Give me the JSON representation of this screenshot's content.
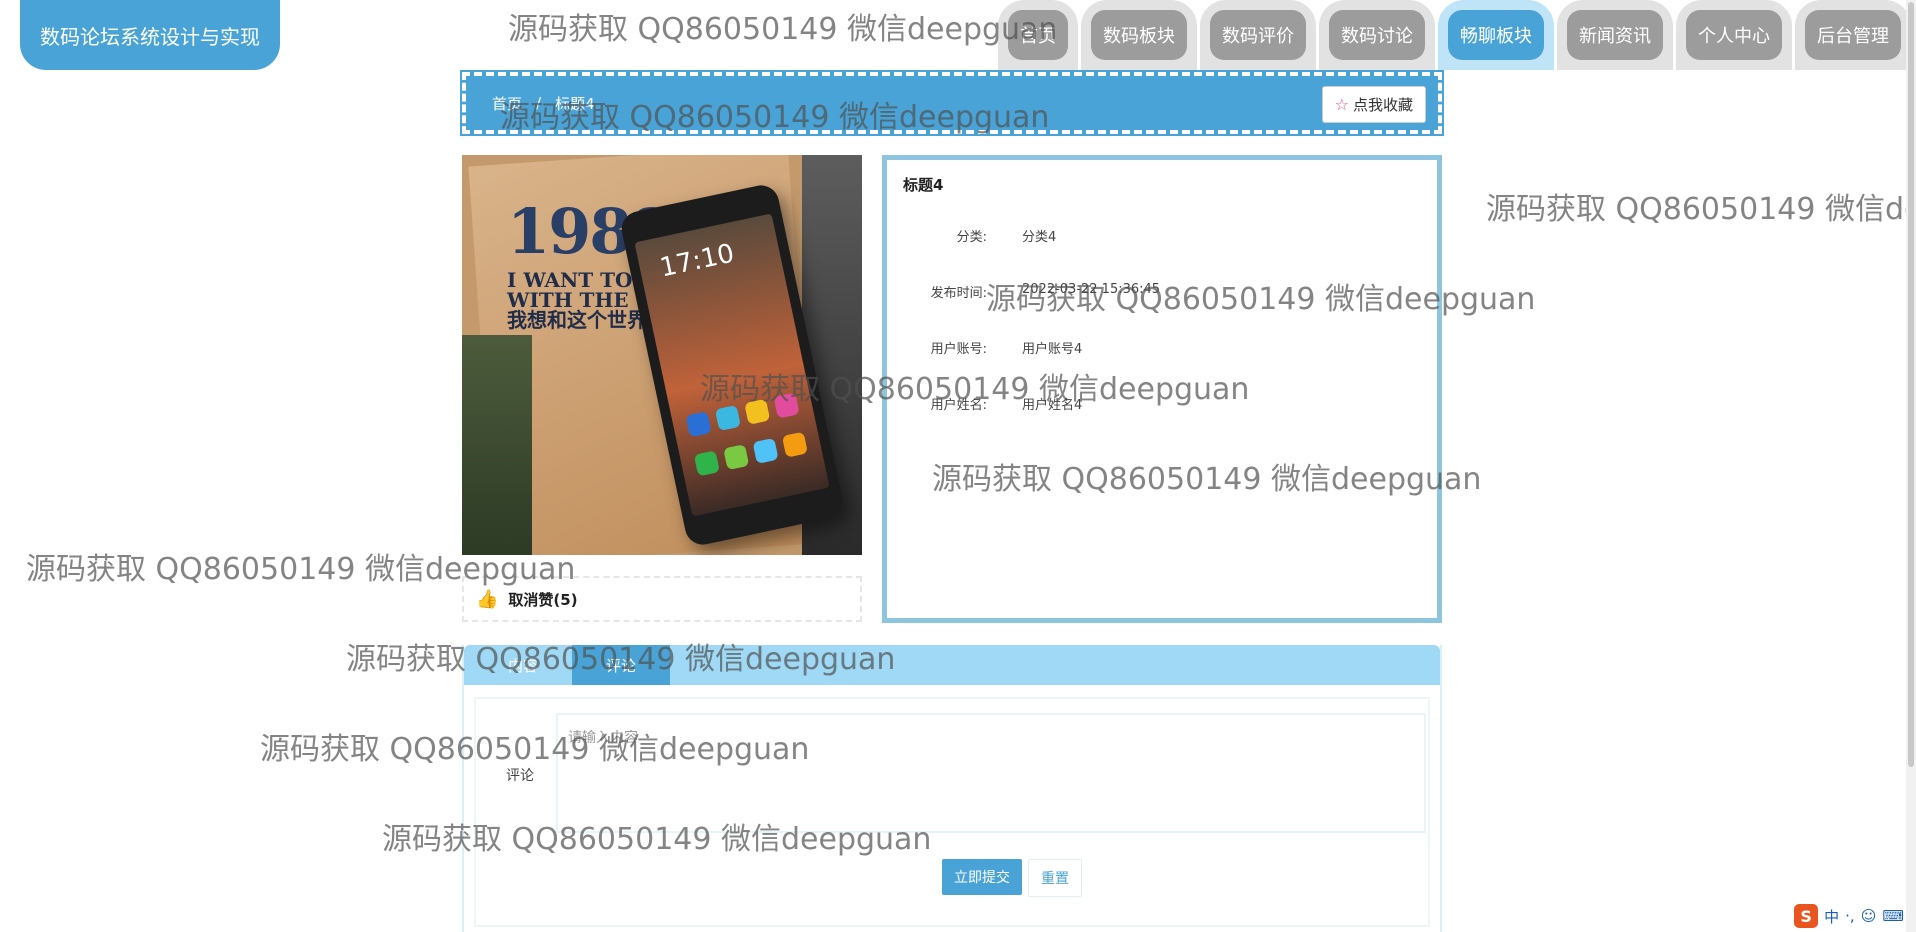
{
  "logo": "数码论坛系统设计与实现",
  "nav": [
    "首页",
    "数码板块",
    "数码评价",
    "数码讨论",
    "畅聊板块",
    "新闻资讯",
    "个人中心",
    "后台管理"
  ],
  "nav_active": "畅聊板块",
  "breadcrumb": {
    "home": "首页",
    "current": "标题4"
  },
  "favorite_label": "点我收藏",
  "photo": {
    "book_title": "1988",
    "book_subtitle_1": "I WANT TO TALK",
    "book_subtitle_2": "WITH THE WORLD",
    "book_subtitle_3": "我想和这个世界",
    "phone_time": "17:10"
  },
  "like_label": "取消赞(5)",
  "info": {
    "title": "标题4",
    "rows": [
      {
        "label": "分类:",
        "value": "分类4"
      },
      {
        "label": "发布时间:",
        "value": "2022-03-22 15:36:45"
      },
      {
        "label": "用户账号:",
        "value": "用户账号4"
      },
      {
        "label": "用户姓名:",
        "value": "用户姓名4"
      }
    ]
  },
  "tabs": [
    "内容",
    "评论"
  ],
  "tab_active": "评论",
  "comment": {
    "label": "评论",
    "placeholder": "请输入内容",
    "submit": "立即提交",
    "reset": "重置"
  },
  "watermark_text": "源码获取 QQ86050149 微信deepguan",
  "ime": {
    "lang": "中",
    "punct": "·,",
    "emoji": "☺",
    "keyboard": "⌨"
  },
  "colors": {
    "primary": "#4aa3d6",
    "tab_bar": "#9fd9f5",
    "panel_border": "#8ec5de"
  }
}
